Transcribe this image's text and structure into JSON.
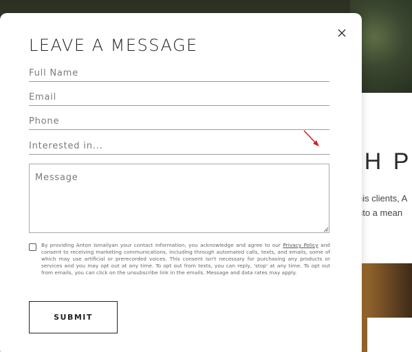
{
  "background": {
    "heading_fragment": "TH P",
    "line1": "his clients, A",
    "line2": "nto a mean"
  },
  "modal": {
    "title": "LEAVE A MESSAGE",
    "close_icon": "close-icon",
    "fields": {
      "full_name": {
        "placeholder": "Full Name",
        "value": ""
      },
      "email": {
        "placeholder": "Email",
        "value": ""
      },
      "phone": {
        "placeholder": "Phone",
        "value": ""
      },
      "interested": {
        "placeholder": "Interested in...",
        "value": ""
      },
      "message": {
        "placeholder": "Message",
        "value": ""
      }
    },
    "consent": {
      "checked": false,
      "text_before": "By providing Anton Ismailyan your contact information, you acknowledge and agree to our ",
      "link_text": "Privacy Policy",
      "text_after": " and consent to receiving marketing communications, including through automated calls, texts, and emails, some of which may use artificial or prerecorded voices. This consent isn't necessary for purchasing any products or services and you may opt out at any time. To opt out from texts, you can reply, 'stop' at any time. To opt out from emails, you can click on the unsubscribe link in the emails. Message and data rates may apply."
    },
    "submit_label": "SUBMIT"
  },
  "colors": {
    "annotation_arrow": "#d42020",
    "text_dark": "#222222"
  }
}
